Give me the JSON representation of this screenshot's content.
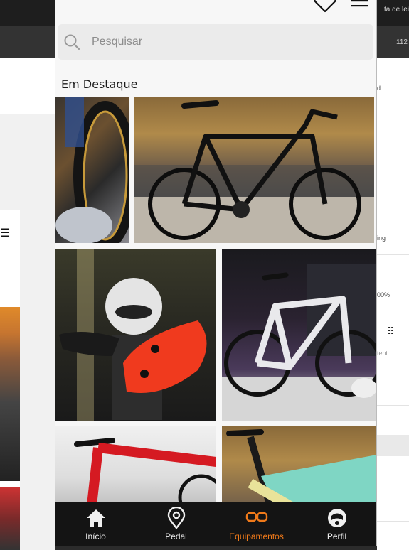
{
  "background": {
    "topbar_right_text": "ta de lei",
    "secondbar_right_text": "112",
    "right_panel_texts": [
      "d",
      "ing",
      "00%",
      "tent."
    ]
  },
  "header": {
    "favorites_icon": "heart-icon",
    "menu_icon": "hamburger-icon"
  },
  "search": {
    "placeholder": "Pesquisar",
    "value": ""
  },
  "featured": {
    "title": "Em Destaque"
  },
  "bottom_nav": {
    "items": [
      {
        "label": "Início",
        "icon": "home-icon",
        "active": false
      },
      {
        "label": "Pedal",
        "icon": "map-pin-icon",
        "active": false
      },
      {
        "label": "Equipamentos",
        "icon": "goggles-icon",
        "active": true
      },
      {
        "label": "Perfil",
        "icon": "profile-icon",
        "active": false
      }
    ]
  },
  "colors": {
    "accent": "#f07a1a",
    "nav_background": "#141414",
    "page_background": "#f7f7f7"
  }
}
